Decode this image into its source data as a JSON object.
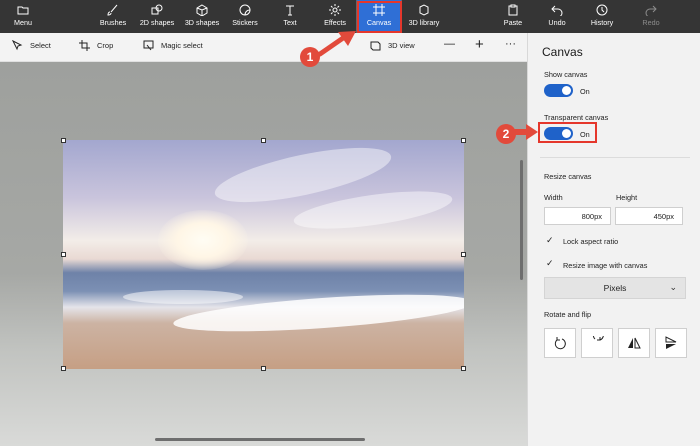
{
  "ribbon": {
    "menu": "Menu",
    "brushes": "Brushes",
    "shapes2d": "2D shapes",
    "shapes3d": "3D shapes",
    "stickers": "Stickers",
    "text": "Text",
    "effects": "Effects",
    "canvas": "Canvas",
    "library3d": "3D library",
    "paste": "Paste",
    "undo": "Undo",
    "history": "History",
    "redo": "Redo"
  },
  "toolbar": {
    "select": "Select",
    "crop": "Crop",
    "magic_select": "Magic select",
    "view3d": "3D view",
    "zoom_out_glyph": "—",
    "zoom_in_glyph": "+",
    "more_glyph": "···"
  },
  "panel": {
    "title": "Canvas",
    "show_canvas_label": "Show canvas",
    "show_canvas_state": "On",
    "transparent_canvas_label": "Transparent canvas",
    "transparent_canvas_state": "On",
    "resize_label": "Resize canvas",
    "width_label": "Width",
    "height_label": "Height",
    "width_value": "800px",
    "height_value": "450px",
    "lock_aspect": "Lock aspect ratio",
    "resize_image": "Resize image with canvas",
    "units_selected": "Pixels",
    "rotate_flip_label": "Rotate and flip"
  },
  "annotations": {
    "step1": "1",
    "step2": "2"
  },
  "icons": [
    "menu-icon",
    "brush-icon",
    "2d-shapes-icon",
    "3d-shapes-icon",
    "sticker-icon",
    "text-icon",
    "effects-icon",
    "canvas-icon",
    "3d-library-icon",
    "paste-icon",
    "undo-icon",
    "history-icon",
    "redo-icon",
    "select-icon",
    "crop-icon",
    "magic-select-icon",
    "3d-view-icon",
    "zoom-out-icon",
    "zoom-in-icon",
    "more-icon",
    "rotate-left-icon",
    "rotate-right-icon",
    "flip-vertical-icon",
    "flip-horizontal-icon",
    "check-icon",
    "chevron-down-icon"
  ],
  "colors": {
    "ribbon_bg": "#353535",
    "accent": "#2f6fd6",
    "toggle_on": "#1f62c9",
    "annotation_red": "#e24a3b"
  }
}
